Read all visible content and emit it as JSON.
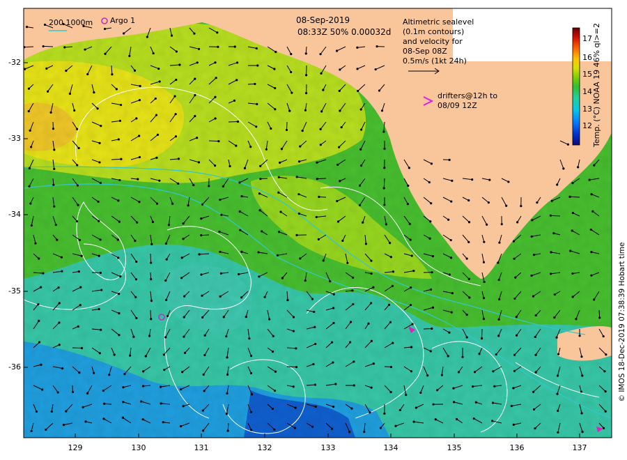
{
  "header": {
    "date": "08-Sep-2019",
    "time_info": "08:33Z  50% 0.00032d",
    "legend_depth": "200  1000m",
    "argo_label": "Argo 1"
  },
  "altimetry_note": {
    "line1": "Altimetric sealevel",
    "line2": "(0.1m contours)",
    "line3": "and velocity for",
    "line4": "08-Sep 08Z",
    "line5": "0.5m/s (1kt 24h)"
  },
  "drifters_note": {
    "symbol": ">",
    "line1": "drifters@12h to",
    "line2": "08/09 12Z"
  },
  "colorbar": {
    "title": "Temp. (°C) NOAA 19 46% ql>=2",
    "ticks": [
      "17",
      "16",
      "15",
      "14",
      "13",
      "12"
    ],
    "colors": [
      "#0a0a6e",
      "#0030d0",
      "#0080ff",
      "#00c8e8",
      "#20d0a0",
      "#30c030",
      "#80d000",
      "#d8e000",
      "#ffc000",
      "#ff6000",
      "#d01000",
      "#6a0000"
    ]
  },
  "axes": {
    "y_ticks": [
      "-32",
      "-33",
      "-34",
      "-35",
      "-36"
    ],
    "x_ticks": [
      "129",
      "130",
      "131",
      "132",
      "133",
      "134",
      "135",
      "136",
      "137"
    ]
  },
  "credit": "© IMOS 18-Dec-2019 07:38:39 Hobart time",
  "colors": {
    "land": "#f9c59b",
    "warm": "#e8e81c",
    "mid": "#50c828",
    "cool": "#30c8a8",
    "cold": "#1890e8",
    "contour": "#ffffff",
    "depth_line": "#30c8d0",
    "argo": "#c030c0"
  }
}
